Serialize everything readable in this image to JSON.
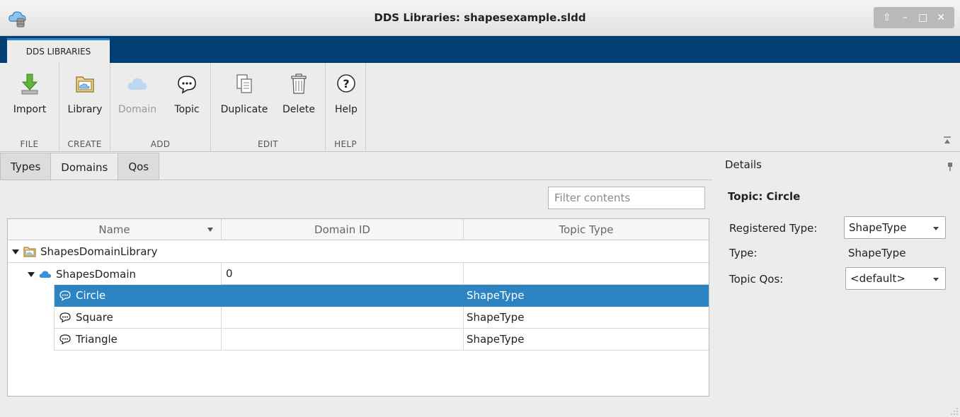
{
  "window": {
    "title": "DDS Libraries: shapesexample.sldd",
    "controls": [
      "maximize-up",
      "minimize",
      "maximize",
      "close"
    ]
  },
  "ribbon": {
    "active_tab": "DDS LIBRARIES",
    "groups": {
      "file": {
        "label": "FILE",
        "buttons": {
          "import": "Import"
        }
      },
      "create": {
        "label": "CREATE",
        "buttons": {
          "library": "Library"
        }
      },
      "add": {
        "label": "ADD",
        "buttons": {
          "domain": "Domain",
          "topic": "Topic"
        }
      },
      "edit": {
        "label": "EDIT",
        "buttons": {
          "duplicate": "Duplicate",
          "delete": "Delete"
        }
      },
      "help": {
        "label": "HELP",
        "buttons": {
          "help": "Help"
        }
      }
    }
  },
  "tabs": {
    "types": "Types",
    "domains": "Domains",
    "qos": "Qos",
    "active": "Domains"
  },
  "filter": {
    "placeholder": "Filter contents",
    "value": ""
  },
  "table": {
    "columns": {
      "name": "Name",
      "domain_id": "Domain ID",
      "topic_type": "Topic Type"
    },
    "rows": [
      {
        "name": "ShapesDomainLibrary",
        "domain_id": "",
        "topic_type": "",
        "kind": "library",
        "expanded": true
      },
      {
        "name": "ShapesDomain",
        "domain_id": "0",
        "topic_type": "",
        "kind": "domain",
        "expanded": true
      },
      {
        "name": "Circle",
        "domain_id": "",
        "topic_type": "ShapeType",
        "kind": "topic",
        "selected": true
      },
      {
        "name": "Square",
        "domain_id": "",
        "topic_type": "ShapeType",
        "kind": "topic"
      },
      {
        "name": "Triangle",
        "domain_id": "",
        "topic_type": "ShapeType",
        "kind": "topic"
      }
    ]
  },
  "details": {
    "title": "Details",
    "heading": "Topic: Circle",
    "registered_type_label": "Registered Type:",
    "registered_type_value": "ShapeType",
    "type_label": "Type:",
    "type_value": "ShapeType",
    "topic_qos_label": "Topic Qos:",
    "topic_qos_value": "<default>"
  },
  "colors": {
    "ribbon_bar": "#003e73",
    "active_tab_accent": "#2b82c9",
    "selection": "#2d84c2",
    "domain_cloud": "#3a8fd9"
  }
}
